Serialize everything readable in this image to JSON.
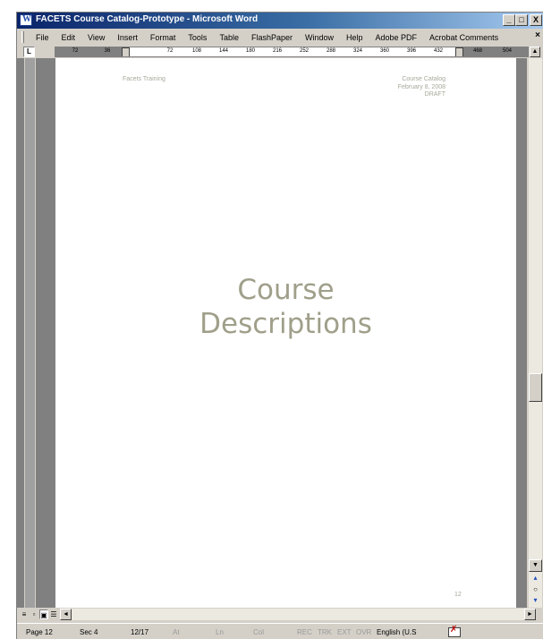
{
  "window": {
    "title": "FACETS Course Catalog-Prototype - Microsoft Word",
    "buttons": {
      "minimize": "_",
      "maximize": "□",
      "close": "X"
    }
  },
  "menubar": {
    "items": [
      "File",
      "Edit",
      "View",
      "Insert",
      "Format",
      "Tools",
      "Table",
      "FlashPaper",
      "Window",
      "Help",
      "Adobe PDF",
      "Acrobat Comments"
    ],
    "close_glyph": "×"
  },
  "ruler": {
    "tab_selector": "L",
    "ticks": [
      "72",
      "36",
      "72",
      "108",
      "144",
      "180",
      "216",
      "252",
      "288",
      "324",
      "360",
      "396",
      "432",
      "468",
      "504"
    ]
  },
  "document": {
    "header_left": "Facets Training",
    "header_right": [
      "Course Catalog",
      "February 8, 2008",
      "DRAFT"
    ],
    "title_lines": [
      "Course",
      "Descriptions"
    ],
    "page_number": "12"
  },
  "statusbar": {
    "page": "Page  12",
    "section": "Sec  4",
    "page_count": "12/17",
    "at": "At",
    "ln": "Ln",
    "col": "Col",
    "rec": "REC",
    "trk": "TRK",
    "ext": "EXT",
    "ovr": "OVR",
    "language": "English (U.S"
  },
  "icons": {
    "app": "word-icon",
    "spelling": "spelling-grammar-icon"
  },
  "colors": {
    "titlebar_start": "#0a246a",
    "titlebar_end": "#a6caf0",
    "title_text": "#a09f8a",
    "chrome": "#d4d0c8"
  }
}
